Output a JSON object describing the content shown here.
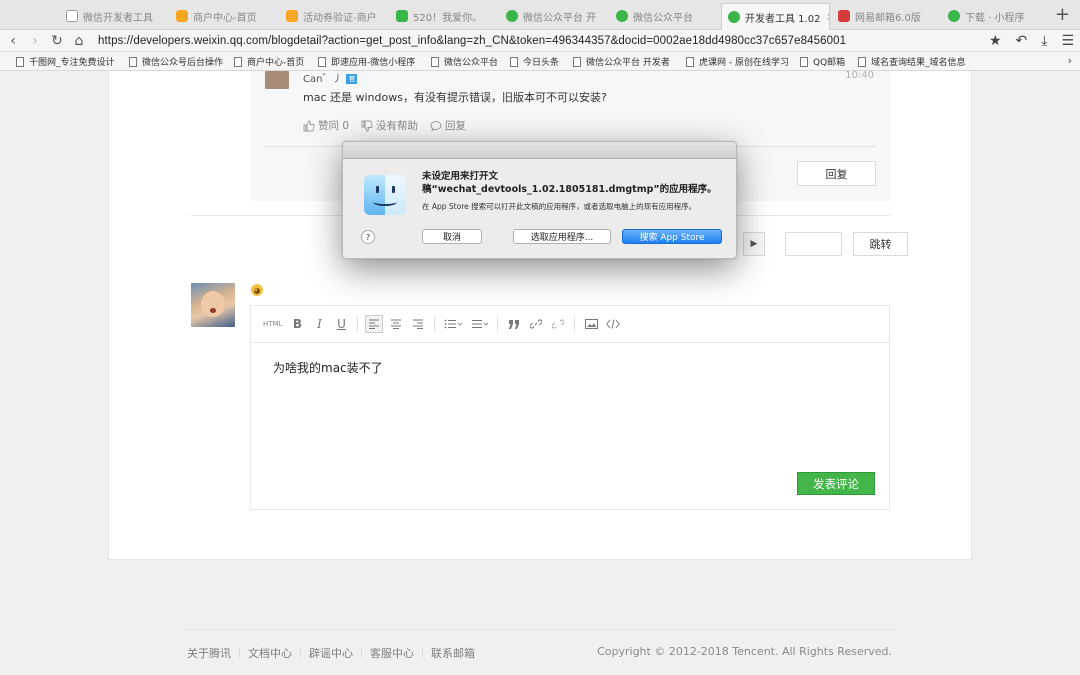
{
  "browser": {
    "tabs": [
      {
        "label": "微信开发者工具",
        "icon_color": "#9e9e9e"
      },
      {
        "label": "商户中心-首页",
        "icon_color": "#f5a623"
      },
      {
        "label": "活动券验证-商户",
        "icon_color": "#f5a623"
      },
      {
        "label": "520！我爱你。",
        "icon_color": "#3bb54a"
      },
      {
        "label": "微信公众平台 开",
        "icon_color": "#3bb54a"
      },
      {
        "label": "微信公众平台",
        "icon_color": "#3bb54a"
      },
      {
        "label": "开发者工具 1.02",
        "icon_color": "#3bb54a",
        "close": "×"
      },
      {
        "label": "网易邮箱6.0版",
        "icon_color": "#d43b3b"
      },
      {
        "label": "下载 · 小程序",
        "icon_color": "#3bb54a"
      }
    ],
    "new_tab": "+",
    "url": "https://developers.weixin.qq.com/blogdetail?action=get_post_info&lang=zh_CN&token=496344357&docid=0002ae18dd4980cc37c657e8456001",
    "icons": [
      "back-icon",
      "forward-icon",
      "reload-icon",
      "home-icon",
      "star-icon",
      "undo-icon",
      "download-icon",
      "menu-icon"
    ],
    "bookmarks": [
      "千图网_专注免费设计",
      "微信公众号后台操作",
      "商户中心-首页",
      "即速应用-微信小程序",
      "微信公众平台",
      "今日头条",
      "微信公众平台 开发者",
      "虎课网 - 原创在线学习",
      "QQ邮箱",
      "域名查询结果_域名信息"
    ],
    "bookmarks_more": "›"
  },
  "reply": {
    "author": "Can゛丿",
    "badge": "官",
    "time": "10:40",
    "text": "mac 还是 windows，有没有提示错误，旧版本可不可以安装?",
    "like_label": "赞同 0",
    "unhelpful_label": "没有帮助",
    "reply_label": "回复",
    "reply_button": "回复"
  },
  "pager": {
    "next": "▶",
    "jump_label": "跳转"
  },
  "editor": {
    "toolbar": [
      "HTML",
      "B",
      "I",
      "U",
      "align-left",
      "align-center",
      "align-right",
      "ordered-list",
      "unordered-list",
      "quote",
      "link",
      "unlink",
      "image",
      "code"
    ],
    "html_label": "HTML",
    "bold_label": "B",
    "italic_label": "I",
    "underline_label": "U",
    "content": "为啥我的mac装不了",
    "submit_label": "发表评论"
  },
  "footer": {
    "links": [
      "关于腾讯",
      "文档中心",
      "辟谣中心",
      "客服中心",
      "联系邮箱"
    ],
    "copyright": "Copyright © 2012-2018 Tencent. All Rights Reserved."
  },
  "dialog": {
    "title_line1": "未设定用来打开文",
    "title_line2": "稿“wechat_devtools_1.02.1805181.dmgtmp”的应用程序。",
    "description": "在 App Store 搜索可以打开此文稿的应用程序，或者选取电脑上的现有应用程序。",
    "help": "?",
    "cancel": "取消",
    "choose": "选取应用程序...",
    "search": "搜索 App Store"
  }
}
